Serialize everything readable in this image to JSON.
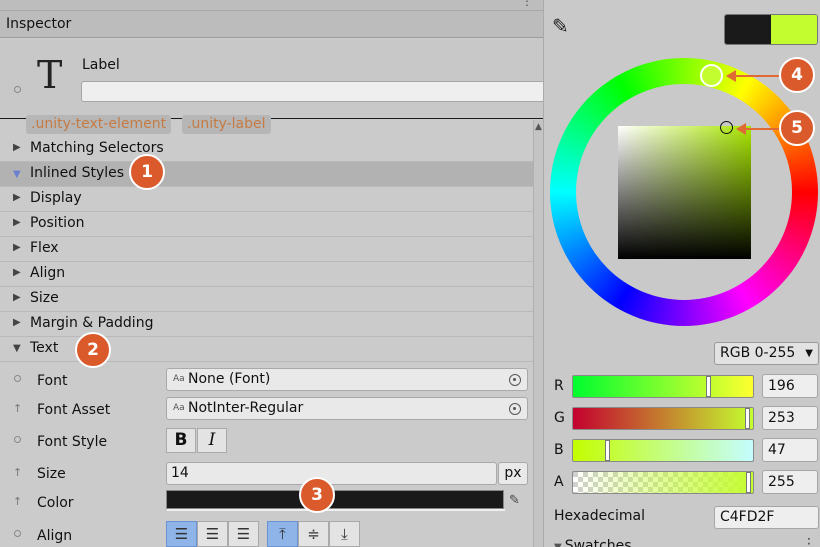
{
  "inspector": {
    "title": "Inspector",
    "element_label": "Label",
    "element_name_value": "",
    "tags": [
      ".unity-text-element",
      ".unity-label"
    ]
  },
  "sections": [
    {
      "label": "Matching Selectors",
      "selected": false,
      "expanded": false
    },
    {
      "label": "Inlined Styles",
      "selected": true,
      "expanded": true
    },
    {
      "label": "Display",
      "selected": false,
      "expanded": false
    },
    {
      "label": "Position",
      "selected": false,
      "expanded": false
    },
    {
      "label": "Flex",
      "selected": false,
      "expanded": false
    },
    {
      "label": "Align",
      "selected": false,
      "expanded": false
    },
    {
      "label": "Size",
      "selected": false,
      "expanded": false
    },
    {
      "label": "Margin & Padding",
      "selected": false,
      "expanded": false
    },
    {
      "label": "Text",
      "selected": false,
      "expanded": true
    }
  ],
  "text_props": {
    "font_label": "Font",
    "font_value": "None (Font)",
    "font_asset_label": "Font Asset",
    "font_asset_value": "NotInter-Regular",
    "font_style_label": "Font Style",
    "bold_glyph": "B",
    "italic_glyph": "I",
    "size_label": "Size",
    "size_value": "14",
    "size_unit": "px",
    "color_label": "Color",
    "color_value": "#1a1a1a",
    "align_label": "Align",
    "field_prefix": "Aa"
  },
  "picker": {
    "old_color": "#1a1a1a",
    "new_color": "#c4fd2f",
    "mode": "RGB 0-255",
    "channels": [
      {
        "label": "R",
        "value": "196",
        "fraction": 0.7686
      },
      {
        "label": "G",
        "value": "253",
        "fraction": 0.9922
      },
      {
        "label": "B",
        "value": "47",
        "fraction": 0.1843
      },
      {
        "label": "A",
        "value": "255",
        "fraction": 1.0
      }
    ],
    "hex_label": "Hexadecimal",
    "hex_value": "C4FD2F",
    "swatches_label": "Swatches"
  },
  "callouts": [
    "1",
    "2",
    "3",
    "4",
    "5"
  ]
}
